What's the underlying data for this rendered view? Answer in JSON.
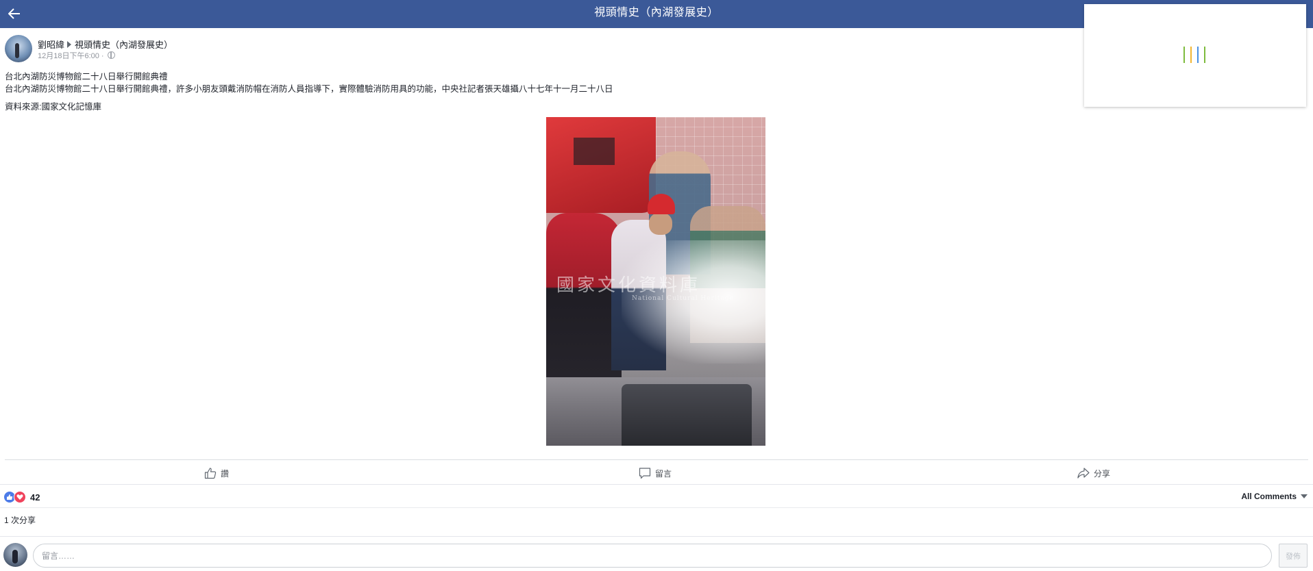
{
  "header": {
    "title": "視頭情史（內湖發展史）",
    "back_icon": "arrow-left-icon",
    "background_color": "#3b5998"
  },
  "loading": {
    "bar_colors": [
      "#7dbb3c",
      "#f2b632",
      "#4a90e2",
      "#7dbb3c"
    ]
  },
  "post": {
    "author": "劉昭緯",
    "target": "視頭情史（內湖發展史）",
    "time": "12月18日下午6:00 ·",
    "lines": [
      "台北內湖防災博物館二十八日舉行開館典禮",
      "台北內湖防災博物館二十八日舉行開館典禮，許多小朋友頭戴消防帽在消防人員指導下，實際體驗消防用具的功能，中央社記者張天雄攝八十七年十一月二十八日"
    ],
    "source": "資料來源:國家文化記憶庫",
    "photo_watermark": "國家文化資料庫",
    "photo_watermark_sub": "National Cultural Heritage"
  },
  "actions": {
    "like_label": "讚",
    "comment_label": "留言",
    "share_label": "分享"
  },
  "stats": {
    "reaction_count": "42",
    "all_comments_label": "All Comments",
    "shares_text": "1 次分享",
    "like_color": "#4c7be8",
    "love_color": "#f0435c"
  },
  "composer": {
    "placeholder": "留言……",
    "post_label": "發佈"
  }
}
